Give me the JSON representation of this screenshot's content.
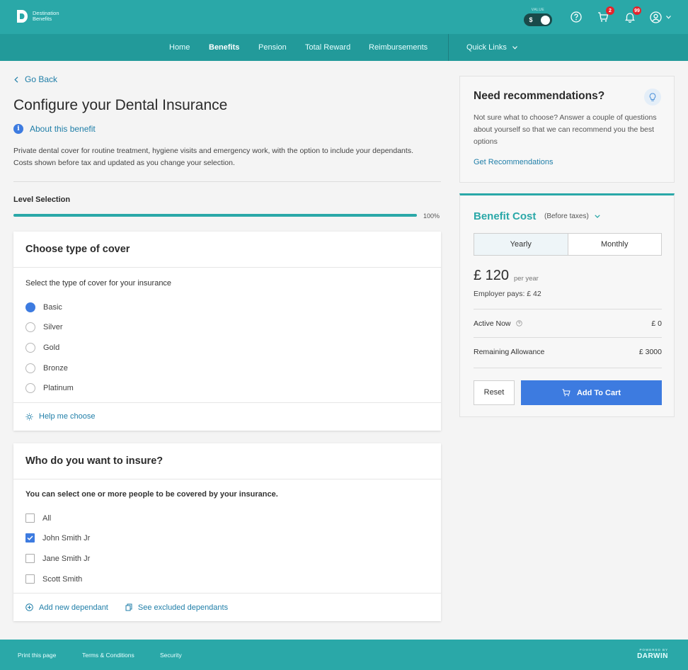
{
  "brand": {
    "line1": "Destination",
    "line2": "Benefits"
  },
  "header": {
    "value_label": "VALUE",
    "currency": "$",
    "cart_badge": "2",
    "notifications_badge": "99"
  },
  "nav": {
    "items": [
      "Home",
      "Benefits",
      "Pension",
      "Total Reward",
      "Reimbursements"
    ],
    "quick_links": "Quick Links"
  },
  "page": {
    "go_back": "Go Back",
    "title": "Configure your Dental Insurance",
    "about": "About this benefit",
    "description": "Private dental cover for routine treatment, hygiene visits and emergency work, with the option to include your dependants. Costs shown before tax and updated as you change your selection.",
    "level_label": "Level Selection",
    "progress_pct": "100%",
    "progress_value": 1.0
  },
  "cover": {
    "title": "Choose type of cover",
    "subtitle": "Select the type of cover for your insurance",
    "options": [
      "Basic",
      "Silver",
      "Gold",
      "Bronze",
      "Platinum"
    ],
    "selected": "Basic",
    "help": "Help me choose"
  },
  "insure": {
    "title": "Who do you want to insure?",
    "subtitle": "You can select one or more people to be covered by your insurance.",
    "people": [
      "All",
      "John Smith Jr",
      "Jane Smith Jr",
      "Scott Smith"
    ],
    "checked": [
      "John Smith Jr"
    ],
    "add_dependant": "Add new dependant",
    "see_excluded": "See excluded dependants"
  },
  "recommend": {
    "title": "Need recommendations?",
    "text": "Not sure what to choose? Answer a couple of questions about yourself so that we can recommend you the best options",
    "link": "Get Recommendations"
  },
  "cost": {
    "title": "Benefit Cost",
    "subtitle": "(Before taxes)",
    "tabs": [
      "Yearly",
      "Monthly"
    ],
    "price": "£ 120",
    "per": "per year",
    "employer": "Employer pays:  £ 42",
    "active_label": "Active Now",
    "active_value": "£ 0",
    "remaining_label": "Remaining Allowance",
    "remaining_value": "£ 3000",
    "reset": "Reset",
    "add_to_cart": "Add To Cart"
  },
  "footer": {
    "links": [
      "Print this page",
      "Terms & Conditions",
      "Security"
    ],
    "powered_by": "POWERED BY",
    "powered_brand": "DARWIN"
  },
  "colors": {
    "teal": "#2aa8a8",
    "blue": "#3d7be0",
    "link": "#1f7ea8",
    "badge": "#e5232b"
  }
}
